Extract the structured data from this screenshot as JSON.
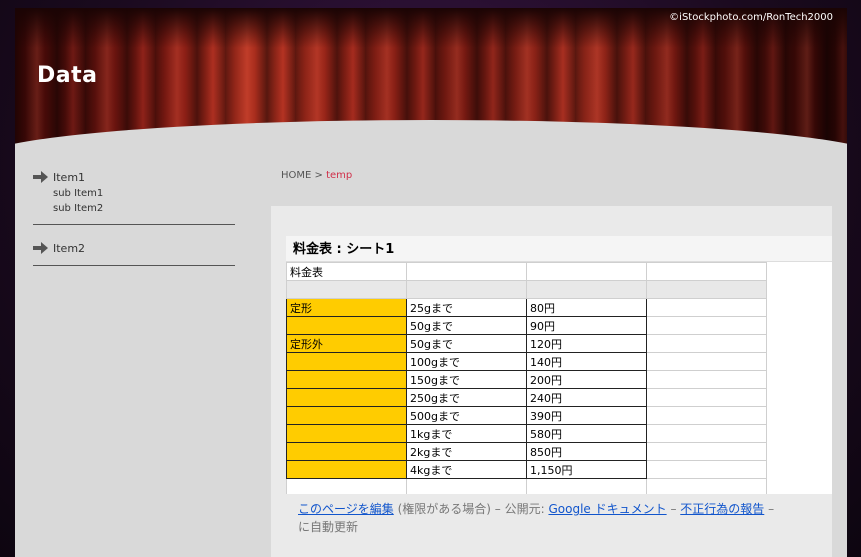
{
  "header": {
    "title": "Data",
    "credit": "©iStockphoto.com/RonTech2000"
  },
  "sidebar": {
    "groups": [
      {
        "label": "Item1",
        "sub": [
          "sub Item1",
          "sub Item2"
        ]
      },
      {
        "label": "Item2",
        "sub": []
      }
    ]
  },
  "breadcrumb": {
    "home": "HOME",
    "sep": " > ",
    "current": "temp"
  },
  "doc": {
    "title": "料金表 : シート1",
    "header_cell": "料金表",
    "rows": [
      {
        "cat": "定形",
        "weight": "25gまで",
        "price": "80円"
      },
      {
        "cat": "",
        "weight": "50gまで",
        "price": "90円"
      },
      {
        "cat": "定形外",
        "weight": "50gまで",
        "price": "120円"
      },
      {
        "cat": "",
        "weight": "100gまで",
        "price": "140円"
      },
      {
        "cat": "",
        "weight": "150gまで",
        "price": "200円"
      },
      {
        "cat": "",
        "weight": "250gまで",
        "price": "240円"
      },
      {
        "cat": "",
        "weight": "500gまで",
        "price": "390円"
      },
      {
        "cat": "",
        "weight": "1kgまで",
        "price": "580円"
      },
      {
        "cat": "",
        "weight": "2kgまで",
        "price": "850円"
      },
      {
        "cat": "",
        "weight": "4kgまで",
        "price": "1,150円"
      }
    ],
    "highlight_color": "#ffcc00"
  },
  "footer": {
    "edit_link": "このページを編集",
    "edit_note": " (権限がある場合)",
    "sep1": "–",
    "published_by": "公開元: ",
    "google_docs_link": "Google ドキュメント",
    "sep2": "–",
    "report_link": "不正行為の報告",
    "sep3": "–",
    "auto_update": "に自動更新"
  }
}
